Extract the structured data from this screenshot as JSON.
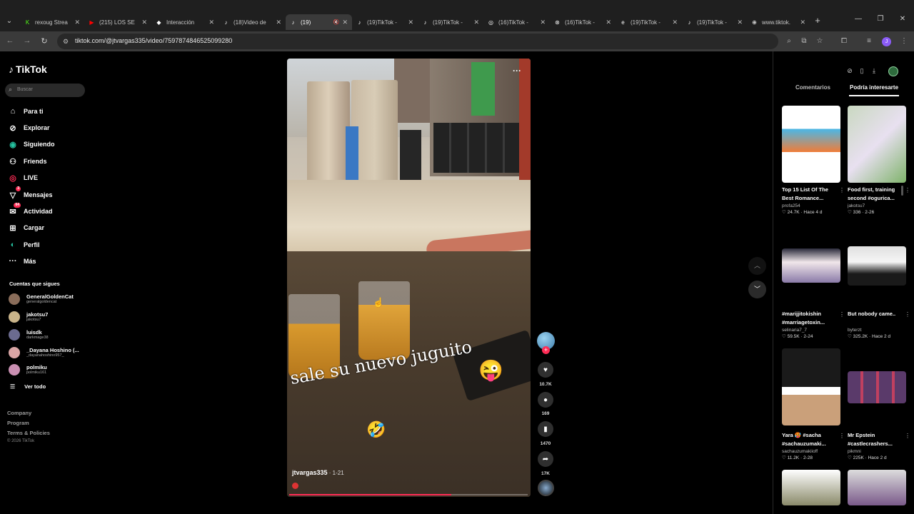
{
  "browser": {
    "tabs": [
      {
        "title": "rexoug Strea",
        "favicon": "kick-icon",
        "color": "#53fc18"
      },
      {
        "title": "(215) LOS SE",
        "favicon": "youtube-icon",
        "color": "#ff0000"
      },
      {
        "title": "Interacción",
        "favicon": "diamond-icon",
        "color": "#ffffff"
      },
      {
        "title": "(18)Video de",
        "favicon": "tiktok-icon",
        "color": "#ffffff"
      },
      {
        "title": "(19)",
        "favicon": "tiktok-icon",
        "color": "#ffffff"
      },
      {
        "title": "(19)TikTok -",
        "favicon": "tiktok-icon",
        "color": "#ffffff"
      },
      {
        "title": "(19)TikTok -",
        "favicon": "tiktok-icon",
        "color": "#ffffff"
      },
      {
        "title": "(16)TikTok -",
        "favicon": "grok-icon",
        "color": "#ffffff"
      },
      {
        "title": "(16)TikTok -",
        "favicon": "chatgpt-icon",
        "color": "#ffffff"
      },
      {
        "title": "(19)TikTok -",
        "favicon": "browser-icon",
        "color": "#ffffff"
      },
      {
        "title": "(19)TikTok -",
        "favicon": "tiktok-icon",
        "color": "#ffffff"
      },
      {
        "title": "www.tiktok.",
        "favicon": "globe-icon",
        "color": "#ffffff"
      }
    ],
    "active_tab": 4,
    "url": "tiktok.com/@jtvargas335/video/7597874846525099280",
    "profile_initial": "J"
  },
  "sidebar": {
    "logo": "TikTok",
    "search_placeholder": "Buscar",
    "nav": [
      {
        "label": "Para ti",
        "icon": "home-icon"
      },
      {
        "label": "Explorar",
        "icon": "compass-icon"
      },
      {
        "label": "Siguiendo",
        "icon": "following-icon"
      },
      {
        "label": "Friends",
        "icon": "friends-icon"
      },
      {
        "label": "LIVE",
        "icon": "live-icon"
      },
      {
        "label": "Mensajes",
        "icon": "messages-icon",
        "badge": "3"
      },
      {
        "label": "Actividad",
        "icon": "activity-icon",
        "badge": "64"
      },
      {
        "label": "Cargar",
        "icon": "upload-icon"
      },
      {
        "label": "Perfil",
        "icon": "profile-icon"
      },
      {
        "label": "Más",
        "icon": "more-icon"
      }
    ],
    "following_title": "Cuentas que sigues",
    "following": [
      {
        "name": "GeneralGoldenCat",
        "handle": "generalgoldencat",
        "color": "#8a6d5a"
      },
      {
        "name": "jakotsu7",
        "handle": "jakotsu7",
        "color": "#c9b48a"
      },
      {
        "name": "luisdk",
        "handle": "darkmage38",
        "color": "#6b6b8f"
      },
      {
        "name": "_Dayana Hoshino (...",
        "handle": "_dayanahoshino957_",
        "color": "#d9a5a5"
      },
      {
        "name": "polmiku",
        "handle": "polmiku161",
        "color": "#c98fb2"
      }
    ],
    "see_all": "Ver todo",
    "footer": [
      "Company",
      "Program",
      "Terms & Policies"
    ],
    "copyright": "© 2026 TikTok"
  },
  "video": {
    "caption": "sale su nuevo juguito",
    "emoji_1": "😜",
    "emoji_2": "🤣",
    "author": "jtvargas335",
    "date": " · 1-21",
    "progress": 0.68
  },
  "actions": {
    "likes": "10.7K",
    "comments": "169",
    "saves": "1470",
    "shares": "17K"
  },
  "right_panel": {
    "tabs": [
      "Comentarios",
      "Podría interesarte"
    ],
    "active_tab": 1,
    "cards": [
      {
        "title": "Top 15 List Of The Best Romance...",
        "author": "profa254",
        "likes": "24.7K",
        "date": "Hace 4 d"
      },
      {
        "title": "Food first, training second #ogurica...",
        "author": "jakotsu7",
        "likes": "336",
        "date": "2-26"
      },
      {
        "title": "#marijjitokishin #marriagetoxin...",
        "author": "selinaria7_7",
        "likes": "59.5K",
        "date": "2-24"
      },
      {
        "title": "But nobody came..",
        "author": "byterzt",
        "likes": "325.2K",
        "date": "Hace 2 d"
      },
      {
        "title": "Yara 🥵 #sacha #sachauzumaki...",
        "author": "sachauzumakiioff",
        "likes": "11.2K",
        "date": "2-28"
      },
      {
        "title": "Mr Epstein #castlecrashers...",
        "author": "pikmni",
        "likes": "225K",
        "date": "Hace 2 d"
      },
      {
        "title": "",
        "author": "",
        "likes": "",
        "date": ""
      },
      {
        "title": "",
        "author": "",
        "likes": "",
        "date": ""
      }
    ]
  }
}
